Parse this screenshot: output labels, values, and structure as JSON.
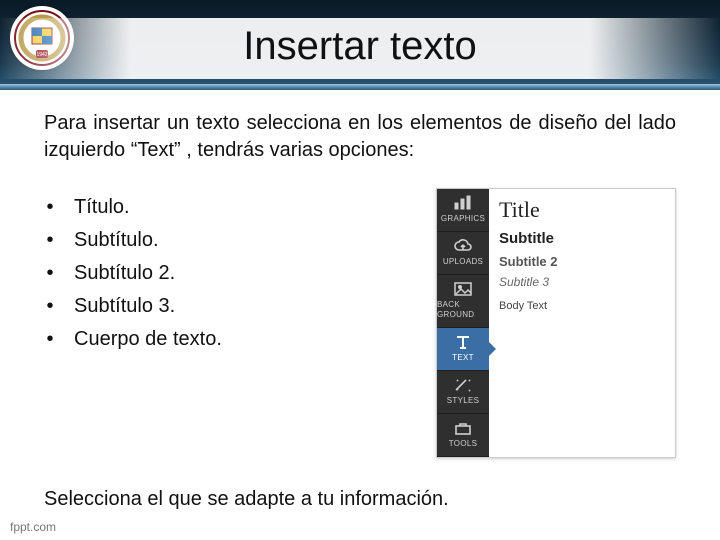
{
  "title": "Insertar texto",
  "intro": "Para insertar un texto selecciona en los elementos de diseño del lado izquierdo “Text” , tendrás varias opciones:",
  "bullets": [
    "Título.",
    "Subtítulo.",
    "Subtítulo 2.",
    "Subtítulo 3.",
    "Cuerpo de texto."
  ],
  "closing": "Selecciona el que se adapte a tu información.",
  "footer": "fppt.com",
  "logo": {
    "year": "1942"
  },
  "panel": {
    "rail": [
      {
        "key": "graphics",
        "label": "GRAPHICS",
        "selected": false
      },
      {
        "key": "uploads",
        "label": "UPLOADS",
        "selected": false
      },
      {
        "key": "back",
        "label": "BACK GROUND",
        "selected": false
      },
      {
        "key": "text",
        "label": "TEXT",
        "selected": true
      },
      {
        "key": "styles",
        "label": "STYLES",
        "selected": false
      },
      {
        "key": "tools",
        "label": "TOOLS",
        "selected": false
      }
    ],
    "options": {
      "title": "Title",
      "subtitle": "Subtitle",
      "sub2": "Subtitle 2",
      "sub3": "Subtitle 3",
      "body": "Body Text"
    }
  }
}
